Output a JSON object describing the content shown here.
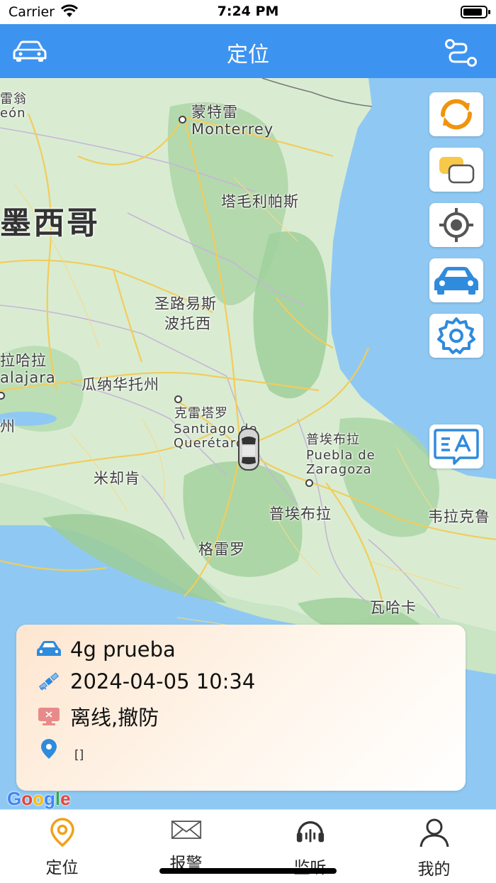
{
  "status_bar": {
    "carrier": "Carrier",
    "time": "7:24 PM"
  },
  "nav": {
    "title": "定位",
    "left_icon": "car-icon",
    "right_icon": "route-icon"
  },
  "map": {
    "labels": {
      "monterrey_cn": "蒙特雷",
      "monterrey_en": "Monterrey",
      "tamaulipas": "塔毛利帕斯",
      "mexico": "墨西哥",
      "slp_1": "圣路易斯",
      "slp_2": "波托西",
      "guadalajara_cn": "拉哈拉",
      "guadalajara_en": "alajara",
      "guanajuato": "瓜纳华托州",
      "jalisco": "州",
      "queretaro_cn": "克雷塔罗",
      "queretaro_en_1": "Santiago de",
      "queretaro_en_2": "Querétaro",
      "puebla_city_cn": "普埃布拉",
      "puebla_city_en_1": "Puebla de",
      "puebla_city_en_2": "Zaragoza",
      "michoacan": "米却肯",
      "puebla_state": "普埃布拉",
      "veracruz": "韦拉克鲁",
      "guerrero": "格雷罗",
      "oaxaca": "瓦哈卡",
      "coahuila_1": "雷翁",
      "coahuila_2": "eón"
    },
    "attribution": "Google"
  },
  "side_buttons": [
    {
      "name": "refresh-button",
      "icon": "refresh-icon"
    },
    {
      "name": "map-type-button",
      "icon": "layers-icon"
    },
    {
      "name": "locate-me-button",
      "icon": "target-icon"
    },
    {
      "name": "locate-car-button",
      "icon": "car-icon"
    },
    {
      "name": "settings-button",
      "icon": "gear-icon"
    },
    {
      "name": "translate-button",
      "icon": "translate-icon"
    }
  ],
  "info_card": {
    "device_name": "4g prueba",
    "timestamp": "2024-04-05 10:34",
    "status": "离线,撤防",
    "address": "[]"
  },
  "tabs": [
    {
      "label": "定位",
      "icon": "location-pin-icon",
      "active": true
    },
    {
      "label": "报警",
      "icon": "mail-icon",
      "active": false
    },
    {
      "label": "监听",
      "icon": "headset-icon",
      "active": false
    },
    {
      "label": "我的",
      "icon": "user-icon",
      "active": false
    }
  ],
  "colors": {
    "primary": "#3d93f0",
    "tab_active": "#f0a11a",
    "sea": "#8fc9f3",
    "land": "#c8e6c4"
  }
}
